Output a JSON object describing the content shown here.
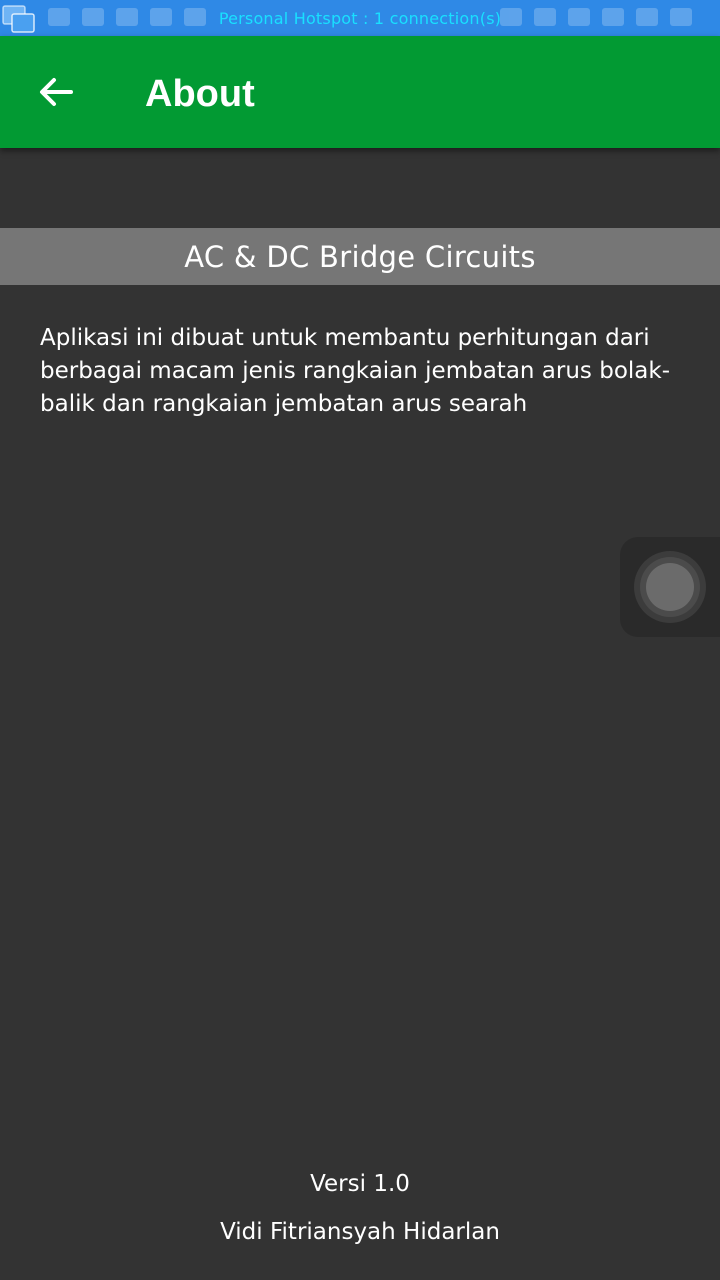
{
  "status_bar": {
    "hotspot_text": "Personal Hotspot  :  1 connection(s)",
    "background_color": "#2f89e6",
    "text_color": "#19e0ff"
  },
  "app_bar": {
    "title": "About",
    "back_icon": "arrow-left-icon",
    "background_color": "#029a33"
  },
  "banner": {
    "title": "AC & DC Bridge Circuits",
    "background_color": "#767676"
  },
  "content": {
    "description": "Aplikasi ini dibuat untuk membantu perhitungan dari berbagai macam jenis rangkaian jembatan arus bolak-balik dan rangkaian jembatan arus searah"
  },
  "footer": {
    "version": "Versi 1.0",
    "author": "Vidi Fitriansyah Hidarlan"
  },
  "overlay": {
    "assistive_icon": "assistive-touch-icon"
  }
}
